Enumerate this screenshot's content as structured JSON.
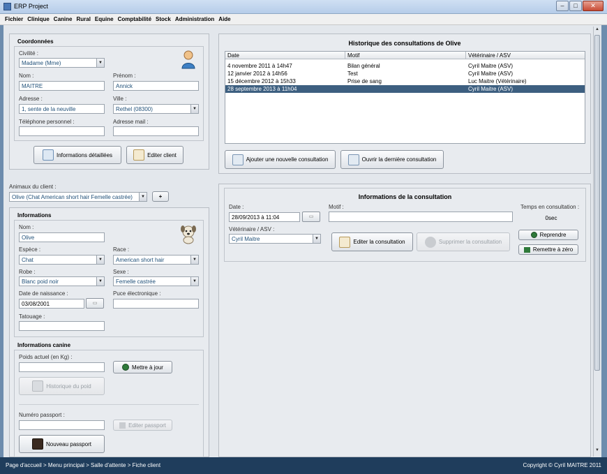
{
  "window": {
    "title": "ERP Project",
    "minimize": "–",
    "maximize": "□",
    "close": "✕"
  },
  "menu": [
    "Fichier",
    "Clinique",
    "Canine",
    "Rural",
    "Equine",
    "Comptabilité",
    "Stock",
    "Administration",
    "Aide"
  ],
  "coordonnees": {
    "header": "Coordonnées",
    "civilite": {
      "label": "Civilité :",
      "value": "Madame (Mme)"
    },
    "nom": {
      "label": "Nom :",
      "value": "MAITRE"
    },
    "prenom": {
      "label": "Prénom :",
      "value": "Annick"
    },
    "adresse": {
      "label": "Adresse :",
      "value": "1, sente de la neuville"
    },
    "ville": {
      "label": "Ville :",
      "value": "Rethel (08300)"
    },
    "telephone": {
      "label": "Téléphone personnel :",
      "value": ""
    },
    "mail": {
      "label": "Adresse mail :",
      "value": ""
    },
    "details_btn": "Informations détaillées",
    "edit_btn": "Editer client"
  },
  "animaux": {
    "label": "Animaux du client :",
    "value": "Olive (Chat American short hair Femelle castrée)",
    "add": "+"
  },
  "informations": {
    "header": "Informations",
    "nom": {
      "label": "Nom :",
      "value": "Olive"
    },
    "espece": {
      "label": "Espèce :",
      "value": "Chat"
    },
    "race": {
      "label": "Race :",
      "value": "American short hair"
    },
    "robe": {
      "label": "Robe :",
      "value": "Blanc poid noir"
    },
    "sexe": {
      "label": "Sexe :",
      "value": "Femelle castrée"
    },
    "naissance": {
      "label": "Date de naissance :",
      "value": "03/08/2001"
    },
    "puce": {
      "label": "Puce électronique :",
      "value": ""
    },
    "tatouage": {
      "label": "Tatouage :",
      "value": ""
    }
  },
  "canine": {
    "header": "Informations canine",
    "poids": {
      "label": "Poids actuel (en Kg) :",
      "value": ""
    },
    "maj_btn": "Mettre à jour",
    "historique_btn": "Historique du poid",
    "passeport": {
      "label": "Numéro passport :",
      "value": ""
    },
    "editer_passeport_btn": "Editer passport",
    "nouveau_passeport_btn": "Nouveau passport"
  },
  "historique": {
    "title": "Historique des consultations de Olive",
    "columns": [
      "Date",
      "Motif",
      "Vétérinaire / ASV"
    ],
    "rows": [
      [
        "4 novembre 2011 à 14h47",
        "Bilan général",
        "Cyril Maitre (ASV)"
      ],
      [
        "12 janvier 2012 à 14h56",
        "Test",
        "Cyril Maitre (ASV)"
      ],
      [
        "15 décembre 2012 à 15h33",
        "Prise de sang",
        "Luc Maitre (Vétérinaire)"
      ],
      [
        "28 septembre 2013 à 11h04",
        "",
        "Cyril Maitre (ASV)"
      ]
    ],
    "selected_row": 3,
    "add_btn": "Ajouter une nouvelle consultation",
    "open_btn": "Ouvrir la dernière consultation"
  },
  "consultation": {
    "title": "Informations de la consultation",
    "date": {
      "label": "Date :",
      "value": "28/09/2013 à 11:04"
    },
    "motif": {
      "label": "Motif :",
      "value": ""
    },
    "temps": {
      "label": "Temps en consultation :",
      "value": "0sec"
    },
    "veterinaire": {
      "label": "Vétérinaire / ASV :",
      "value": "Cyril Maitre"
    },
    "editer_btn": "Editer la consultation",
    "supprimer_btn": "Supprimer la consultation",
    "reprendre_btn": "Reprendre",
    "remettre_btn": "Remettre à zéro"
  },
  "status": {
    "breadcrumb": "Page d'accueil > Menu principal > Salle d'attente > Fiche client",
    "copyright": "Copyright © Cyril MAITRE 2011"
  }
}
